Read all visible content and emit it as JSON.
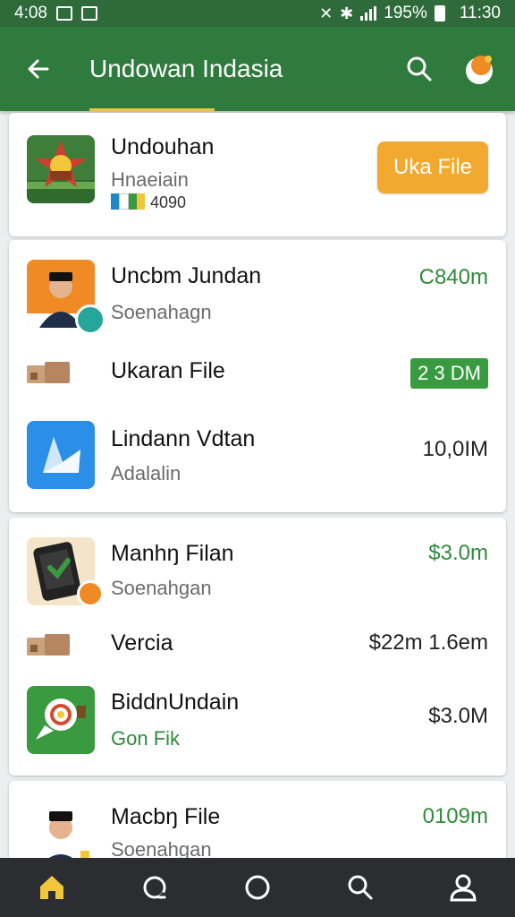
{
  "status_bar": {
    "time_left": "4:08",
    "battery_percent": "195%",
    "time_right": "11:30"
  },
  "app_bar": {
    "title": "Undowan Indasia",
    "back_icon": "arrow-left-icon",
    "search_icon": "search-icon",
    "avatar_icon": "app-logo-icon"
  },
  "card1": {
    "title": "Undouhan",
    "subtitle": "Hnaeiain",
    "meta": "4090",
    "button_label": "Uka File"
  },
  "card2": {
    "rows": [
      {
        "title": "Uncbm Jundan",
        "subtitle": "Soenahagn",
        "value": "C840m"
      },
      {
        "title": "Ukaran File",
        "value": "2 3 DM"
      },
      {
        "title": "Lindann Vdtan",
        "subtitle": "Adalalin",
        "value": "10,0IM"
      }
    ]
  },
  "card3": {
    "rows": [
      {
        "title": "Manhŋ Filan",
        "subtitle": "Soenahgan",
        "value": "$3.0m"
      },
      {
        "title": "Vercia",
        "value": "$22m  1.6em"
      },
      {
        "title": "BiddnUndain",
        "subtitle": "Gon Fik",
        "value": "$3.0M"
      }
    ]
  },
  "card4": {
    "rows": [
      {
        "title": "Macbŋ File",
        "subtitle": "Soenahgan",
        "value": "0109m"
      }
    ]
  },
  "bottom_nav": {
    "items": [
      "home-icon",
      "chat-icon",
      "circle-icon",
      "search-icon",
      "profile-icon"
    ]
  },
  "colors": {
    "appbar": "#2f7a3d",
    "statusbar": "#2e6a3a",
    "accent_orange": "#f2a92f",
    "value_green": "#2f8a3a",
    "bottom_nav": "#2b2d30"
  }
}
